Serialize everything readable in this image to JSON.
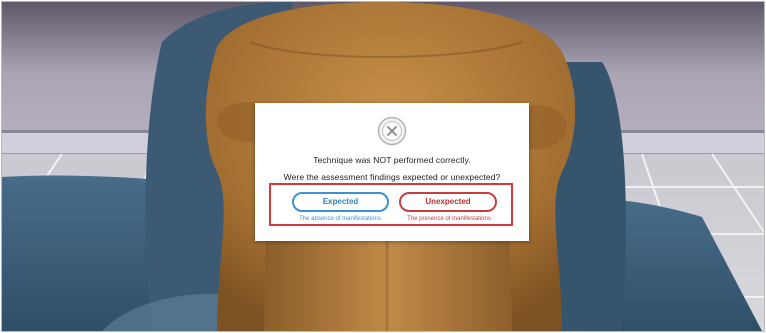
{
  "dialog": {
    "status_icon": "circle-x-icon",
    "message": "Technique was NOT performed correctly.",
    "question": "Were the assessment findings expected or unexpected?",
    "expected": {
      "label": "Expected",
      "hint": "The absence of manifestations"
    },
    "unexpected": {
      "label": "Unexpected",
      "hint": "The presence of manifestations"
    }
  },
  "colors": {
    "expected_accent": "#3d92d6",
    "unexpected_accent": "#c44040",
    "highlight_box": "#d13b3b"
  }
}
